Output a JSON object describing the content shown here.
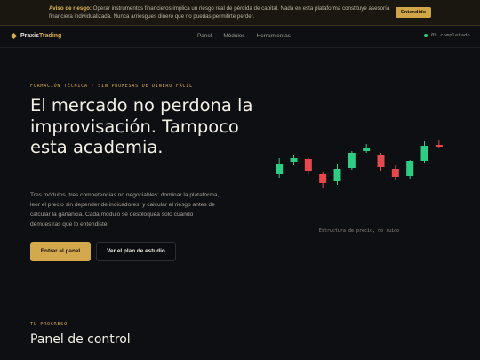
{
  "banner": {
    "heading": "Aviso de riesgo:",
    "text": "Operar instrumentos financieros implica un riesgo real de pérdida de capital. Nada en esta plataforma constituye asesoría financiera individualizada. Nunca arriesgues dinero que no puedas permitirte perder.",
    "button": "Entendido"
  },
  "nav": {
    "logo_part1": "Praxis",
    "logo_part2": "Trading",
    "links": [
      "Panel",
      "Módulos",
      "Herramientas"
    ],
    "progress": "0% completado"
  },
  "hero": {
    "eyebrow": "FORMACIÓN TÉCNICA · SIN PROMESAS DE DINERO FÁCIL",
    "title": "El mercado no perdona la improvisación. Tampoco esta academia.",
    "description": "Tres módulos, tres competencias no negociables: dominar la plataforma, leer el precio sin depender de indicadores, y calcular el riesgo antes de calcular la ganancia. Cada módulo se desbloquea solo cuando demuestras que lo entendiste.",
    "primary_button": "Entrar al panel",
    "secondary_button": "Ver el plan de estudio"
  },
  "chart": {
    "caption": "Estructura de precio, no ruido",
    "colors": {
      "bull": "#2ecc85",
      "bear": "#e5484d"
    },
    "candles": [
      {
        "o": 48,
        "c": 60,
        "h": 66,
        "l": 44
      },
      {
        "o": 62,
        "c": 66,
        "h": 70,
        "l": 58
      },
      {
        "o": 65,
        "c": 52,
        "h": 67,
        "l": 48
      },
      {
        "o": 48,
        "c": 38,
        "h": 51,
        "l": 33
      },
      {
        "o": 40,
        "c": 54,
        "h": 60,
        "l": 36
      },
      {
        "o": 55,
        "c": 72,
        "h": 74,
        "l": 53
      },
      {
        "o": 74,
        "c": 77,
        "h": 82,
        "l": 72
      },
      {
        "o": 70,
        "c": 56,
        "h": 72,
        "l": 52
      },
      {
        "o": 54,
        "c": 45,
        "h": 58,
        "l": 42
      },
      {
        "o": 46,
        "c": 63,
        "h": 64,
        "l": 43
      },
      {
        "o": 63,
        "c": 80,
        "h": 85,
        "l": 61
      },
      {
        "o": 81,
        "c": 79,
        "h": 87,
        "l": 78
      }
    ]
  },
  "section": {
    "eyebrow": "TU PROGRESO",
    "title": "Panel de control"
  }
}
